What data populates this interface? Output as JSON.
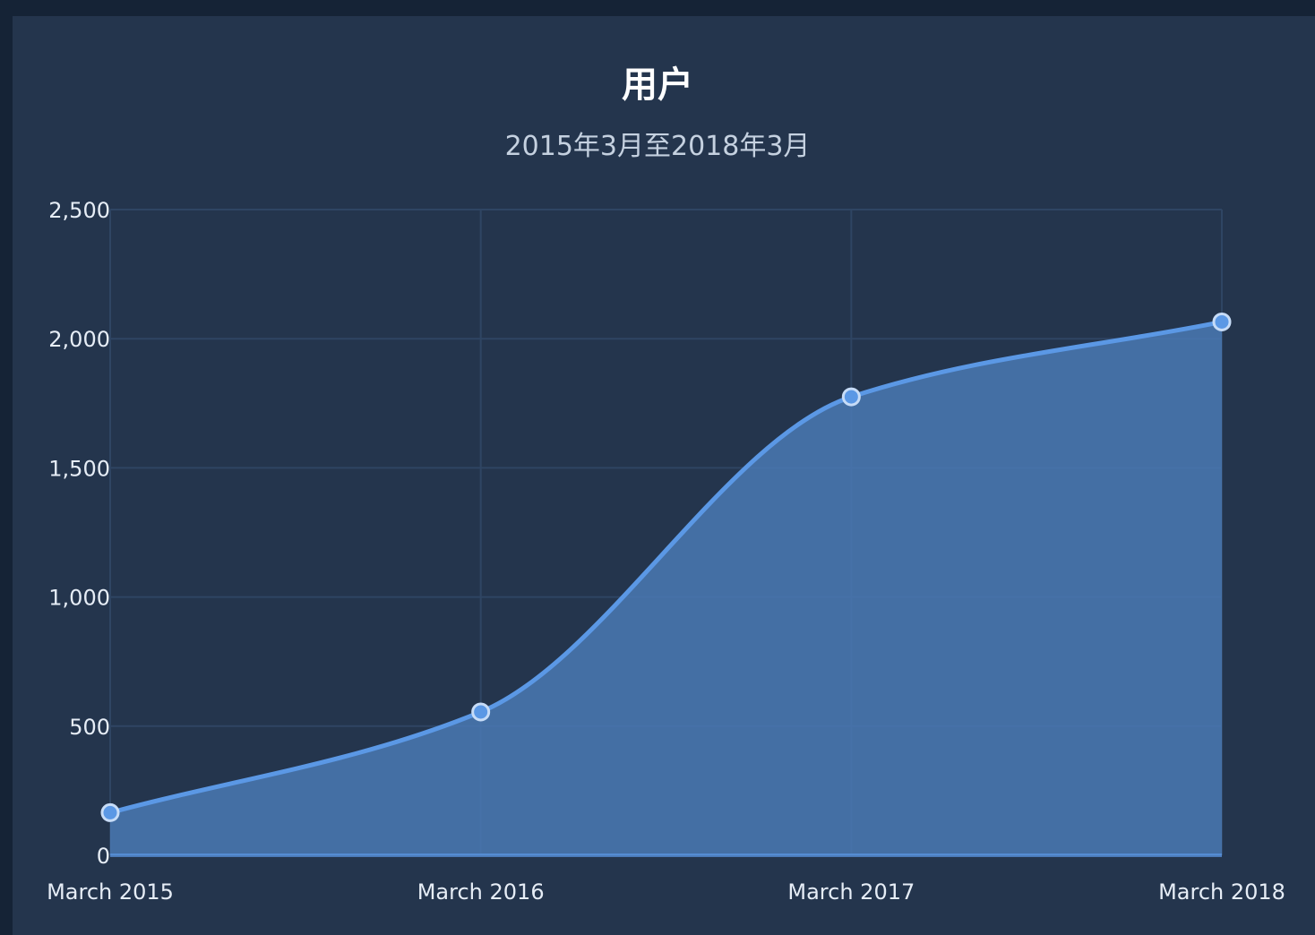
{
  "chart_data": {
    "type": "area",
    "title": "用户",
    "subtitle": "2015年3月至2018年3月",
    "categories": [
      "March 2015",
      "March 2016",
      "March 2017",
      "March 2018"
    ],
    "values": [
      165,
      555,
      1775,
      2065
    ],
    "ylim": [
      0,
      2500
    ],
    "yticks": [
      0,
      500,
      1000,
      1500,
      2000,
      2500
    ],
    "ytick_labels": [
      "0",
      "500",
      "1,000",
      "1,500",
      "2,000",
      "2,500"
    ],
    "xlabel": "",
    "ylabel": "",
    "grid": true,
    "legend": "none",
    "colors": {
      "line": "#5b98e5",
      "fill": "#4a79b4",
      "point_fill": "#5b98e5",
      "point_stroke": "#c7dcf7",
      "grid": "#2f4563"
    }
  }
}
